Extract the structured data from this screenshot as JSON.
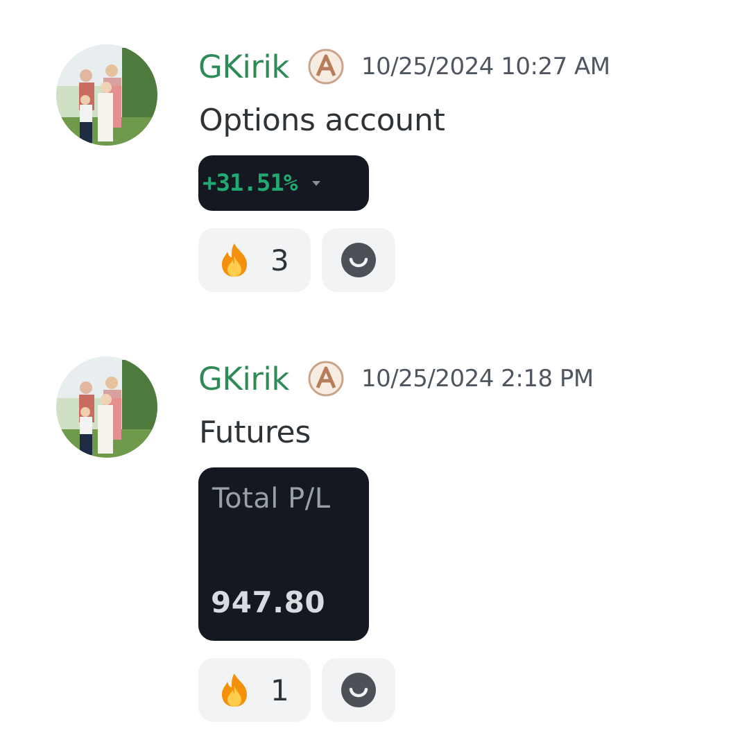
{
  "messages": [
    {
      "username": "GKirik",
      "timestamp": "10/25/2024 10:27 AM",
      "text": "Options account",
      "card": {
        "type": "percent",
        "value": "+31.51%"
      },
      "reaction": {
        "icon": "fire-emoji",
        "count": "3"
      }
    },
    {
      "username": "GKirik",
      "timestamp": "10/25/2024 2:18 PM",
      "text": "Futures",
      "card": {
        "type": "pl",
        "label": "Total P/L",
        "value": "947.80"
      },
      "reaction": {
        "icon": "fire-emoji",
        "count": "1"
      }
    }
  ],
  "colors": {
    "username": "#2e8b57",
    "card_bg": "#141821",
    "gain_green": "#22a870",
    "reaction_bg": "#f2f3f5"
  }
}
